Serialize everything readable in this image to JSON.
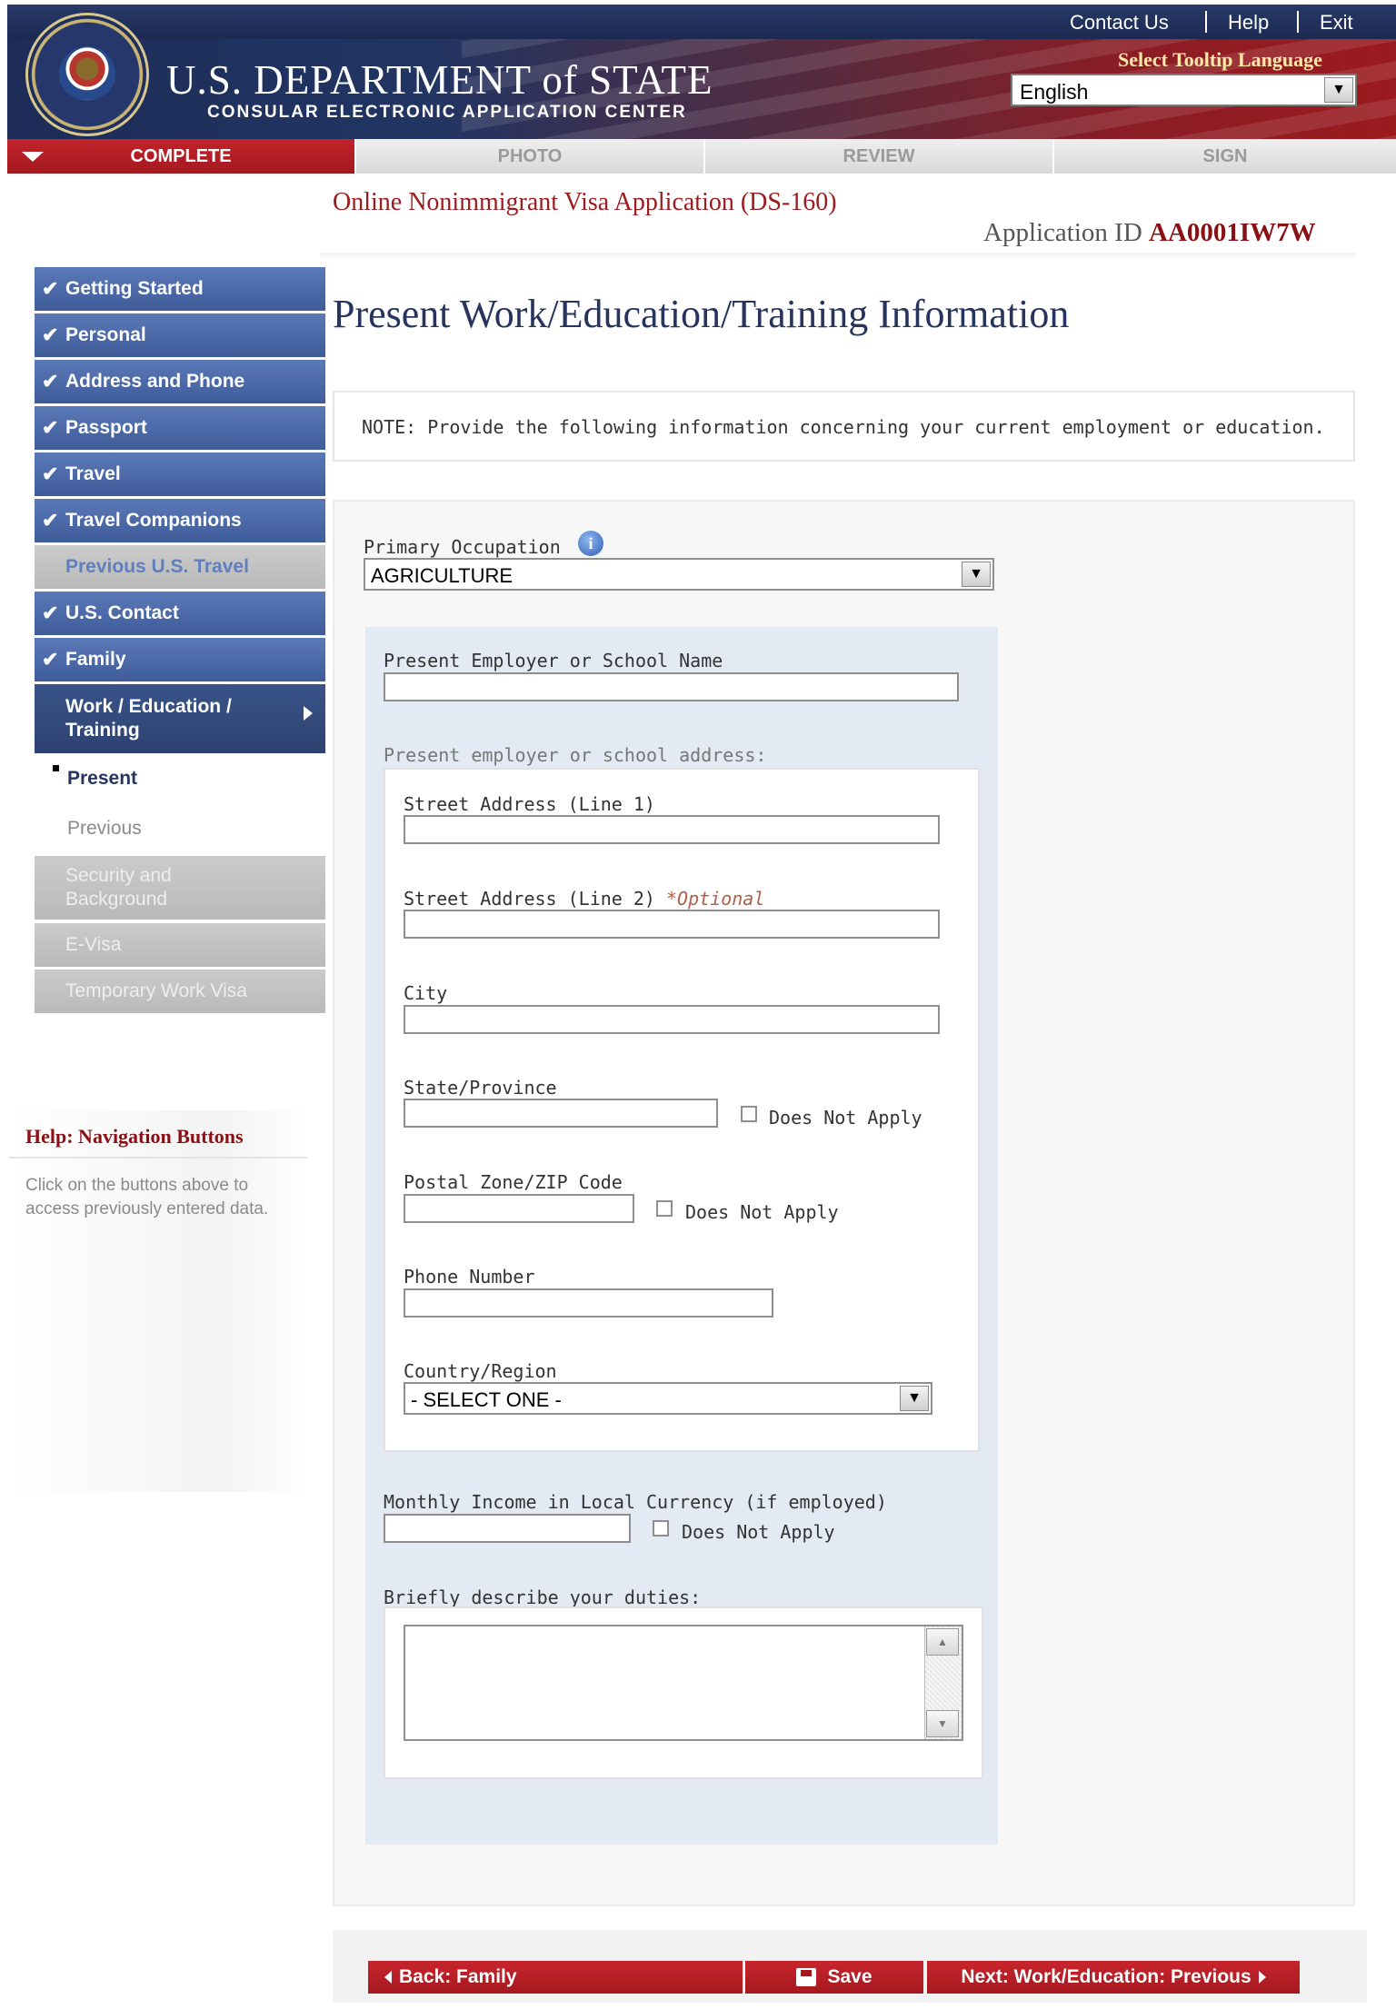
{
  "header": {
    "links": [
      "Contact Us",
      "Help",
      "Exit"
    ],
    "title": "U.S. DEPARTMENT of STATE",
    "subtitle": "CONSULAR ELECTRONIC APPLICATION CENTER",
    "tooltip_language_label": "Select Tooltip Language",
    "tooltip_language_value": "English"
  },
  "steps": [
    "COMPLETE",
    "PHOTO",
    "REVIEW",
    "SIGN"
  ],
  "app": {
    "title": "Online Nonimmigrant Visa Application (DS-160)",
    "id_label": "Application ID",
    "id_value": "AA0001IW7W"
  },
  "sidebar": {
    "items": [
      {
        "label": "Getting Started",
        "status": "done"
      },
      {
        "label": "Personal",
        "status": "done"
      },
      {
        "label": "Address and Phone",
        "status": "done"
      },
      {
        "label": "Passport",
        "status": "done"
      },
      {
        "label": "Travel",
        "status": "done"
      },
      {
        "label": "Travel Companions",
        "status": "done"
      },
      {
        "label": "Previous U.S. Travel",
        "status": "pending"
      },
      {
        "label": "U.S. Contact",
        "status": "done"
      },
      {
        "label": "Family",
        "status": "done"
      },
      {
        "label": "Work / Education / Training",
        "status": "current"
      },
      {
        "label": "Security and Background",
        "status": "disabled"
      },
      {
        "label": "E-Visa",
        "status": "disabled"
      },
      {
        "label": "Temporary Work Visa",
        "status": "disabled"
      }
    ],
    "subitems": [
      "Present",
      "Previous"
    ],
    "help_title": "Help: Navigation Buttons",
    "help_text": "Click on the buttons above to access previously entered data."
  },
  "main": {
    "heading": "Present Work/Education/Training Information",
    "note": "NOTE: Provide the following information concerning your current employment or education.",
    "primary_occupation_label": "Primary Occupation",
    "primary_occupation_value": "AGRICULTURE",
    "employer_label": "Present Employer or School Name",
    "address_heading": "Present employer or school address:",
    "street1_label": "Street Address (Line 1)",
    "street2_label": "Street Address (Line 2)",
    "optional_label": "*Optional",
    "city_label": "City",
    "state_label": "State/Province",
    "postal_label": "Postal Zone/ZIP Code",
    "phone_label": "Phone Number",
    "country_label": "Country/Region",
    "country_value": "- SELECT ONE -",
    "income_label": "Monthly Income in Local Currency (if employed)",
    "duties_label": "Briefly describe your duties:",
    "does_not_apply": "Does Not Apply"
  },
  "buttons": {
    "back": "Back: Family",
    "save": "Save",
    "next": "Next: Work/Education: Previous"
  },
  "colors": {
    "brand_red": "#a5181f",
    "nav_blue": "#4a67a6",
    "nav_current": "#2d4271",
    "heading_navy": "#26345e"
  }
}
